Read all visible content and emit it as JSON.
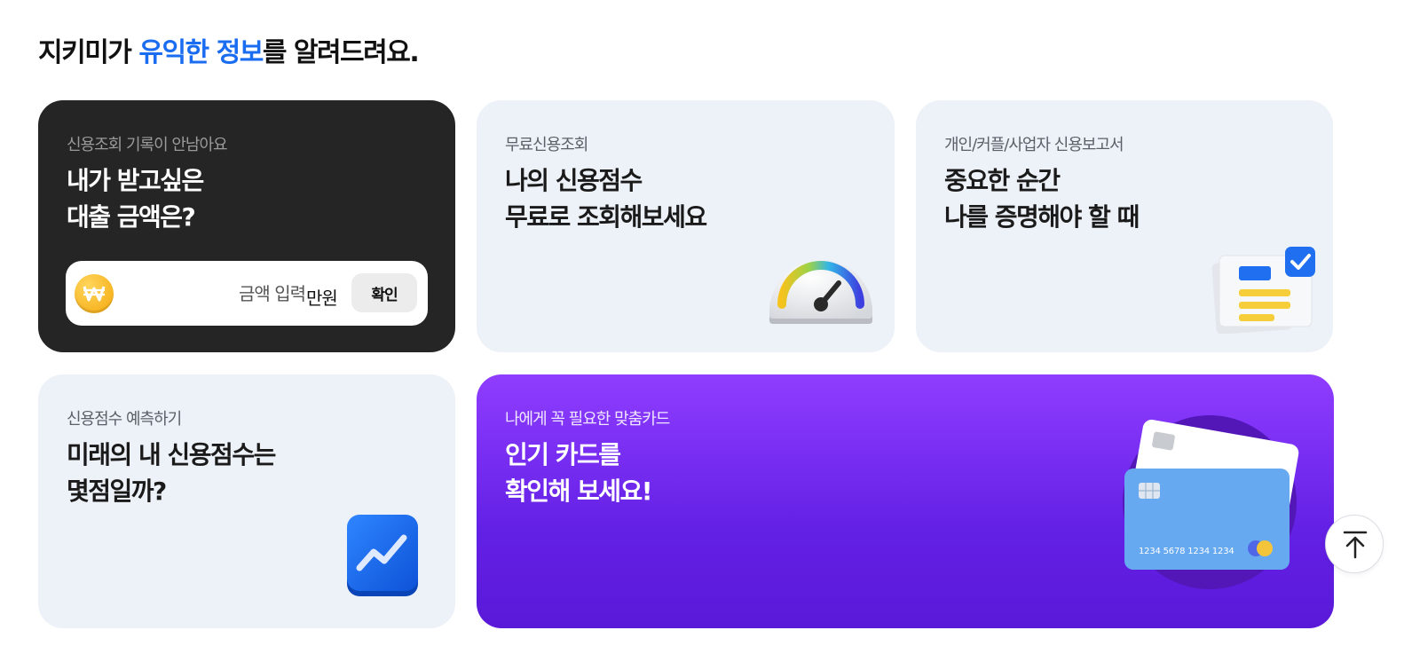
{
  "heading": {
    "prefix": "지키미가 ",
    "highlight": "유익한 정보",
    "suffix": "를 알려드려요."
  },
  "cards": {
    "loan": {
      "eyebrow": "신용조회 기록이 안남아요",
      "title_line1": "내가 받고싶은",
      "title_line2": "대출 금액은?",
      "amount_placeholder": "금액 입력",
      "unit": "만원",
      "confirm_label": "확인",
      "coin_icon": "won-coin-icon"
    },
    "free_credit": {
      "eyebrow": "무료신용조회",
      "title_line1": "나의 신용점수",
      "title_line2": "무료로 조회해보세요",
      "icon": "speedometer-gauge-icon"
    },
    "report": {
      "eyebrow": "개인/커플/사업자 신용보고서",
      "title_line1": "중요한 순간",
      "title_line2": "나를 증명해야 할 때",
      "icon": "verified-document-icon"
    },
    "predict": {
      "eyebrow": "신용점수 예측하기",
      "title_line1": "미래의 내 신용점수는",
      "title_line2": "몇점일까?",
      "icon": "trend-chart-icon"
    },
    "card_reco": {
      "eyebrow": "나에게 꼭 필요한 맞춤카드",
      "title_line1": "인기 카드를",
      "title_line2": "확인해 보세요!",
      "card_number": "1234 5678 1234 1234",
      "icon": "credit-cards-icon"
    }
  },
  "scroll_top": {
    "icon": "arrow-up-to-top-icon"
  },
  "colors": {
    "accent": "#1a6cf0",
    "dark_card": "#252525",
    "light_card": "#edf1f8",
    "purple_top": "#8f3dff",
    "purple_bottom": "#5a18d8"
  }
}
